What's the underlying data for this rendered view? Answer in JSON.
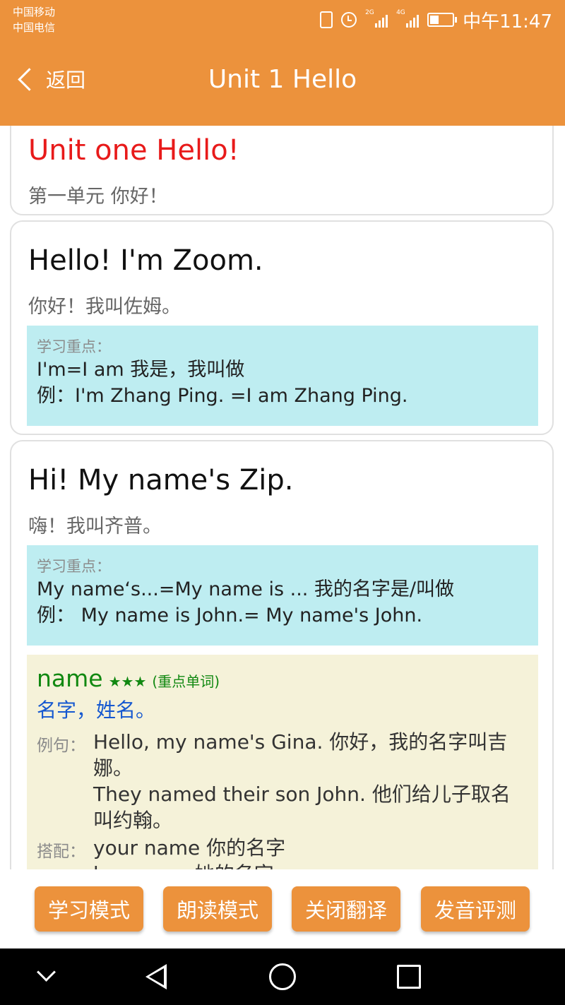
{
  "status": {
    "carrier1": "中国移动",
    "carrier2": "中国电信",
    "net1": "2G",
    "net2": "4G",
    "time": "中午11:47"
  },
  "header": {
    "back_label": "返回",
    "title": "Unit 1 Hello"
  },
  "cards": [
    {
      "en": "Unit one Hello!",
      "zh": "第一单元 你好！"
    },
    {
      "en": "Hello! I'm Zoom.",
      "zh": "你好！我叫佐姆。",
      "key_heading": "学习重点：",
      "key_lines": [
        "I'm=I am 我是，我叫做",
        "例：I'm Zhang Ping. =I am Zhang Ping."
      ]
    },
    {
      "en": "Hi! My name's Zip.",
      "zh": "嗨！我叫齐普。",
      "key_heading": "学习重点：",
      "key_lines": [
        "My name‘s...=My name is ... 我的名字是/叫做",
        "例： My name is John.= My name's John."
      ],
      "vocab": {
        "word": "name",
        "stars": "★★★",
        "importance": "(重点单词)",
        "meaning": "名字，姓名。",
        "example_label": "例句：",
        "examples": [
          "Hello, my name's Gina. 你好，我的名字叫吉娜。",
          "They named their son John. 他们给儿子取名叫约翰。"
        ],
        "collocation_label": "搭配：",
        "collocations": [
          "your name 你的名字",
          "her name 她的名字"
        ]
      }
    }
  ],
  "buttons": [
    "学习模式",
    "朗读模式",
    "关闭翻译",
    "发音评测"
  ],
  "colors": {
    "accent": "#EC923C",
    "title_red": "#E81A1A",
    "key_bg": "#BEEDF1",
    "vocab_bg": "#F5F2D9"
  }
}
